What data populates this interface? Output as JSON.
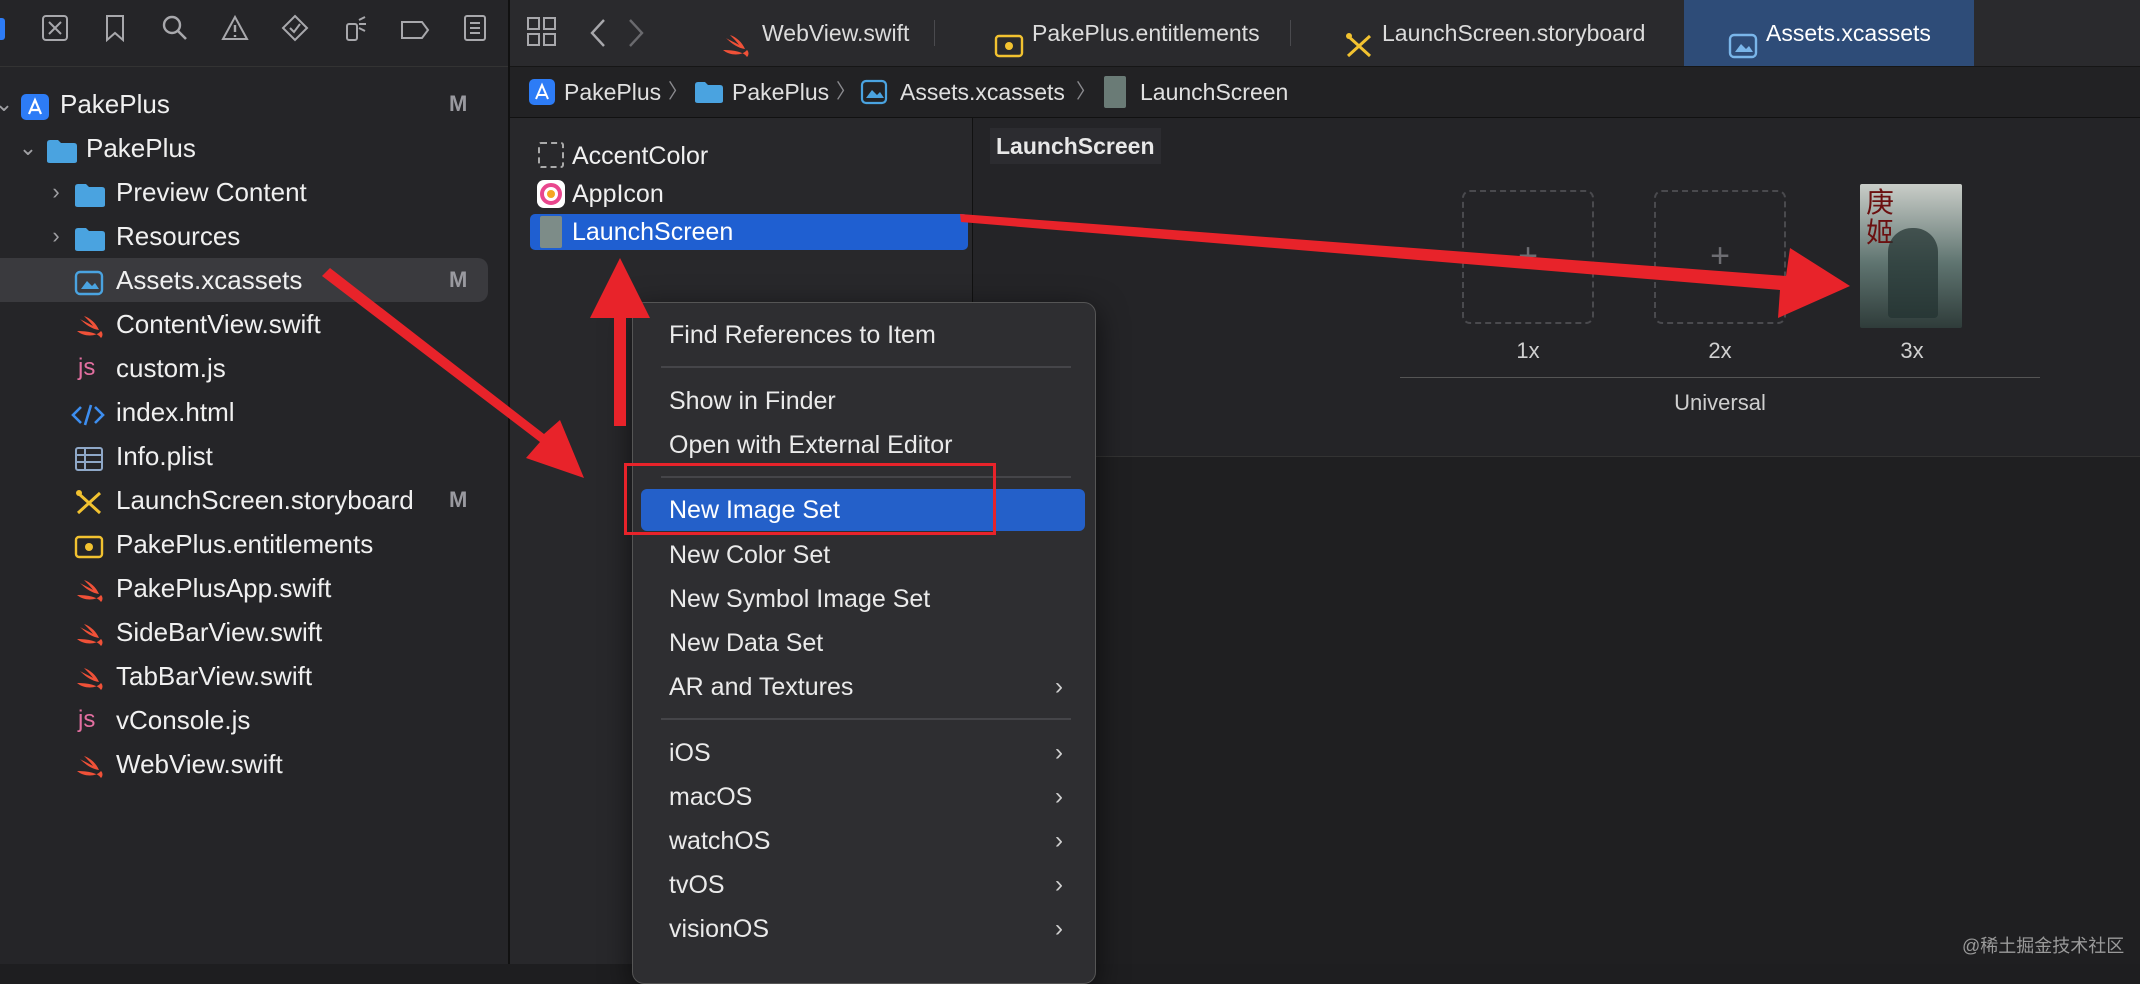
{
  "navigator": {
    "tree": [
      {
        "label": "PakePlus",
        "icon": "xcode-project-icon",
        "badge": "M",
        "expanded": true
      },
      {
        "label": "PakePlus",
        "icon": "folder-icon",
        "expanded": true
      },
      {
        "label": "Preview Content",
        "icon": "folder-icon",
        "expanded": false
      },
      {
        "label": "Resources",
        "icon": "folder-icon",
        "expanded": false
      },
      {
        "label": "Assets.xcassets",
        "icon": "asset-catalog-icon",
        "badge": "M"
      },
      {
        "label": "ContentView.swift",
        "icon": "swift-file-icon"
      },
      {
        "label": "custom.js",
        "icon": "js-file-icon"
      },
      {
        "label": "index.html",
        "icon": "html-file-icon"
      },
      {
        "label": "Info.plist",
        "icon": "plist-file-icon"
      },
      {
        "label": "LaunchScreen.storyboard",
        "icon": "storyboard-file-icon",
        "badge": "M"
      },
      {
        "label": "PakePlus.entitlements",
        "icon": "entitlements-file-icon"
      },
      {
        "label": "PakePlusApp.swift",
        "icon": "swift-file-icon"
      },
      {
        "label": "SideBarView.swift",
        "icon": "swift-file-icon"
      },
      {
        "label": "TabBarView.swift",
        "icon": "swift-file-icon"
      },
      {
        "label": "vConsole.js",
        "icon": "js-file-icon"
      },
      {
        "label": "WebView.swift",
        "icon": "swift-file-icon"
      }
    ]
  },
  "tabs": [
    {
      "label": "WebView.swift",
      "icon": "swift-file-icon"
    },
    {
      "label": "PakePlus.entitlements",
      "icon": "entitlements-file-icon"
    },
    {
      "label": "LaunchScreen.storyboard",
      "icon": "storyboard-file-icon"
    },
    {
      "label": "Assets.xcassets",
      "icon": "asset-catalog-icon",
      "active": true
    }
  ],
  "breadcrumb": [
    "PakePlus",
    "PakePlus",
    "Assets.xcassets",
    "LaunchScreen"
  ],
  "assets": [
    {
      "label": "AccentColor",
      "icon": "color-set-icon"
    },
    {
      "label": "AppIcon",
      "icon": "app-icon-set-icon"
    },
    {
      "label": "LaunchScreen",
      "icon": "image-set-icon",
      "selected": true
    }
  ],
  "detail": {
    "title": "LaunchScreen",
    "slots": [
      {
        "label": "1x",
        "filled": false
      },
      {
        "label": "2x",
        "filled": false
      },
      {
        "label": "3x",
        "filled": true
      }
    ],
    "group_label": "Universal",
    "thumbnail_text": "庚姬"
  },
  "context_menu": {
    "items": [
      {
        "label": "Find References to Item"
      },
      {
        "separator": true
      },
      {
        "label": "Show in Finder"
      },
      {
        "label": "Open with External Editor"
      },
      {
        "separator": true
      },
      {
        "label": "New Image Set",
        "highlighted": true
      },
      {
        "label": "New Color Set"
      },
      {
        "label": "New Symbol Image Set"
      },
      {
        "label": "New Data Set"
      },
      {
        "label": "AR and Textures",
        "submenu": true
      },
      {
        "separator": true
      },
      {
        "label": "iOS",
        "submenu": true
      },
      {
        "label": "macOS",
        "submenu": true
      },
      {
        "label": "watchOS",
        "submenu": true
      },
      {
        "label": "tvOS",
        "submenu": true
      },
      {
        "label": "visionOS",
        "submenu": true
      }
    ]
  },
  "watermark": "@稀土掘金技术社区",
  "colors": {
    "accent": "#1f5fd1",
    "annotation_red": "#e8232a",
    "swift_orange": "#f05138",
    "folder_blue": "#4aa3e0"
  }
}
